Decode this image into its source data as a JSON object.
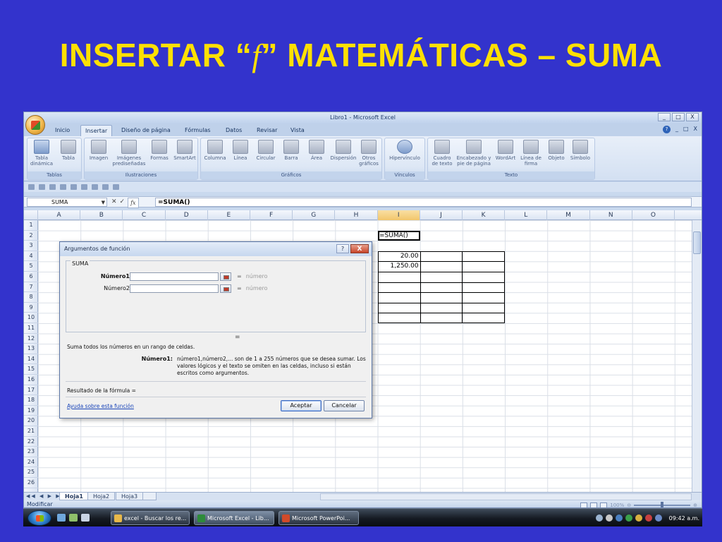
{
  "slide": {
    "title_prefix": "INSERTAR  “",
    "title_f": "f",
    "title_suffix": "” MATEMÁTICAS – SUMA"
  },
  "excel": {
    "window_title": "Libro1 - Microsoft Excel",
    "window_buttons": [
      "_",
      "□",
      "X"
    ],
    "tabs": [
      "Inicio",
      "Insertar",
      "Diseño de página",
      "Fórmulas",
      "Datos",
      "Revisar",
      "Vista"
    ],
    "active_tab": "Insertar",
    "ribbon_groups": [
      {
        "label": "Tablas",
        "buttons": [
          "Tabla dinámica",
          "Tabla"
        ]
      },
      {
        "label": "Ilustraciones",
        "buttons": [
          "Imagen",
          "Imágenes prediseñadas",
          "Formas",
          "SmartArt"
        ]
      },
      {
        "label": "Gráficos",
        "buttons": [
          "Columna",
          "Línea",
          "Circular",
          "Barra",
          "Área",
          "Dispersión",
          "Otros gráficos"
        ]
      },
      {
        "label": "Vínculos",
        "buttons": [
          "Hipervínculo"
        ]
      },
      {
        "label": "Texto",
        "buttons": [
          "Cuadro de texto",
          "Encabezado y pie de página",
          "WordArt",
          "Línea de firma",
          "Objeto",
          "Símbolo"
        ]
      }
    ],
    "name_box": "SUMA",
    "fx_label": "fx",
    "formula": "=SUMA()",
    "columns": [
      "A",
      "B",
      "C",
      "D",
      "E",
      "F",
      "G",
      "H",
      "I",
      "J",
      "K",
      "L",
      "M",
      "N",
      "O"
    ],
    "selected_column": "I",
    "rows": [
      "1",
      "2",
      "3",
      "4",
      "5",
      "6",
      "7",
      "8",
      "9",
      "10",
      "11",
      "12",
      "13",
      "14",
      "15",
      "16",
      "17",
      "18",
      "19",
      "20",
      "21",
      "22",
      "23",
      "24",
      "25",
      "26"
    ],
    "cells": {
      "I2": "=SUMA()",
      "I4": "20.00",
      "I5": "1,250.00"
    },
    "sheet_tabs": [
      "Hoja1",
      "Hoja2",
      "Hoja3"
    ],
    "active_sheet": "Hoja1",
    "sheet_nav": "◀◀ ◀ ▶ ▶▶",
    "status": "Modificar",
    "zoom": "100%"
  },
  "dialog": {
    "title": "Argumentos de función",
    "help_button": "?",
    "close_button": "X",
    "function_name": "SUMA",
    "args": [
      {
        "label": "Número1",
        "result": "número"
      },
      {
        "label": "Número2",
        "result": "número"
      }
    ],
    "eq_sign": "=",
    "result_equals": "=",
    "description": "Suma todos los números en un rango de celdas.",
    "arg_detail_name": "Número1:",
    "arg_detail_text": "número1,número2,... son de 1 a 255 números que se desea sumar. Los valores lógicos y el texto se omiten en las celdas, incluso si están escritos como argumentos.",
    "formula_result": "Resultado de la fórmula =",
    "help_link": "Ayuda sobre esta función",
    "ok_button": "Aceptar",
    "cancel_button": "Cancelar"
  },
  "taskbar": {
    "tasks": [
      {
        "label": "excel - Buscar los re...",
        "color": "#E8B84A"
      },
      {
        "label": "Microsoft Excel - Lib...",
        "color": "#2E8B3A"
      },
      {
        "label": "Microsoft PowerPoi...",
        "color": "#D04A2A"
      }
    ],
    "active_task": "Microsoft Excel - Lib...",
    "clock": "09:42 a.m."
  },
  "colors": {
    "slide_bg": "#3333CC",
    "title_yellow": "#FFE000"
  }
}
